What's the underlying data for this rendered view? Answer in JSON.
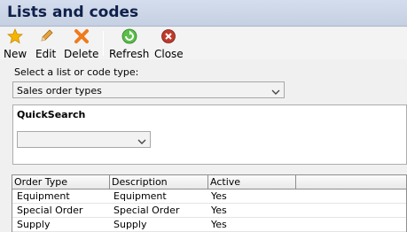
{
  "window": {
    "title": "Lists and codes"
  },
  "toolbar": {
    "new_label": "New",
    "edit_label": "Edit",
    "delete_label": "Delete",
    "refresh_label": "Refresh",
    "close_label": "Close"
  },
  "selector": {
    "label": "Select a list or code type:",
    "value": "Sales order types"
  },
  "quicksearch": {
    "title": "QuickSearch",
    "value": ""
  },
  "grid": {
    "columns": [
      "Order Type",
      "Description",
      "Active"
    ],
    "rows": [
      {
        "order_type": "Equipment",
        "description": "Equipment",
        "active": "Yes"
      },
      {
        "order_type": "Special Order",
        "description": "Special Order",
        "active": "Yes"
      },
      {
        "order_type": "Supply",
        "description": "Supply",
        "active": "Yes"
      }
    ]
  },
  "colors": {
    "title_text": "#10204a",
    "titlebar_bg": "#c9d3e5",
    "new_icon": "#f5b400",
    "delete_icon": "#f07a1a",
    "refresh_icon": "#3aa63a",
    "close_icon": "#c0392b"
  },
  "icons": {
    "new": "star-icon",
    "edit": "pencil-icon",
    "delete": "x-icon",
    "refresh": "refresh-icon",
    "close": "close-circle-icon"
  }
}
